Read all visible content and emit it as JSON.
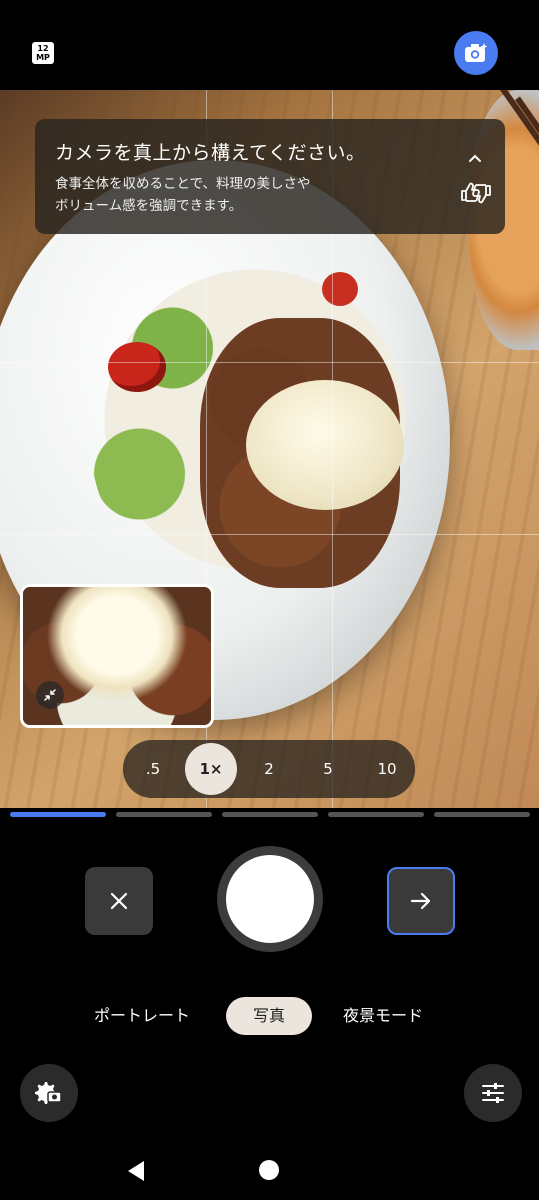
{
  "top_bar": {
    "mp_badge_top": "12",
    "mp_badge_bottom": "MP",
    "ai_button_icon": "camera-sparkle-icon",
    "ai_button_color": "#4a7bf0"
  },
  "tip": {
    "title": "カメラを真上から構えてください。",
    "body_line1": "食事全体を収めることで、料理の美しさや",
    "body_line2": "ボリューム感を強調できます。",
    "collapse_icon": "chevron-up-icon",
    "feedback_icon": "thumbs-up-down-icon"
  },
  "pip": {
    "shrink_icon": "shrink-arrows-icon"
  },
  "zoom": {
    "options": [
      ".5",
      "1×",
      "2",
      "5",
      "10"
    ],
    "selected": "1×"
  },
  "progress": {
    "segments": 5,
    "active_index": 0,
    "active_color": "#4a7bf0"
  },
  "controls": {
    "cancel_icon": "close-icon",
    "next_icon": "arrow-right-icon",
    "next_border_color": "#4a7bf0"
  },
  "modes": {
    "items": [
      "ポートレート",
      "写真",
      "夜景モード"
    ],
    "selected": "写真"
  },
  "bottom": {
    "settings_icon": "camera-settings-icon",
    "adjust_icon": "sliders-icon"
  },
  "nav": {
    "back_icon": "back-triangle-icon",
    "home_icon": "home-circle-icon"
  }
}
